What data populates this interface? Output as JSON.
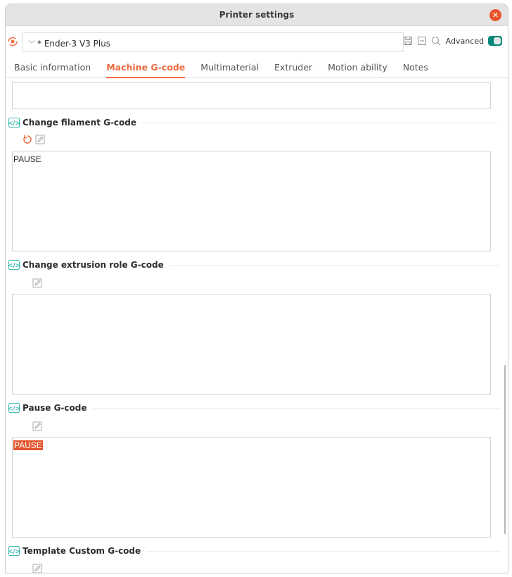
{
  "window": {
    "title": "Printer settings",
    "close_icon": "close-icon"
  },
  "preset": {
    "sync_icon": "sync-icon",
    "selected": "* Ender-3 V3 Plus",
    "chevron_icon": "chevron-down-icon",
    "save_icon": "save-icon",
    "remove_icon": "remove-icon",
    "search_icon": "search-icon",
    "advanced_label": "Advanced",
    "advanced_enabled": true
  },
  "tabs": [
    {
      "label": "Basic information",
      "active": false
    },
    {
      "label": "Machine G-code",
      "active": true
    },
    {
      "label": "Multimaterial",
      "active": false
    },
    {
      "label": "Extruder",
      "active": false
    },
    {
      "label": "Motion ability",
      "active": false
    },
    {
      "label": "Notes",
      "active": false
    }
  ],
  "sections": [
    {
      "label": "Change filament G-code",
      "value": "PAUSE",
      "has_reset": true
    },
    {
      "label": "Change extrusion role G-code",
      "value": "",
      "has_reset": false
    },
    {
      "label": "Pause G-code",
      "value": "PAUSE",
      "selected": true,
      "has_reset": false
    },
    {
      "label": "Template Custom G-code",
      "value": "",
      "has_reset": false
    }
  ],
  "colors": {
    "accent": "#ec6b3f",
    "toggle": "#00897b",
    "code_icon": "#00a99d",
    "selection": "#e2572f"
  }
}
